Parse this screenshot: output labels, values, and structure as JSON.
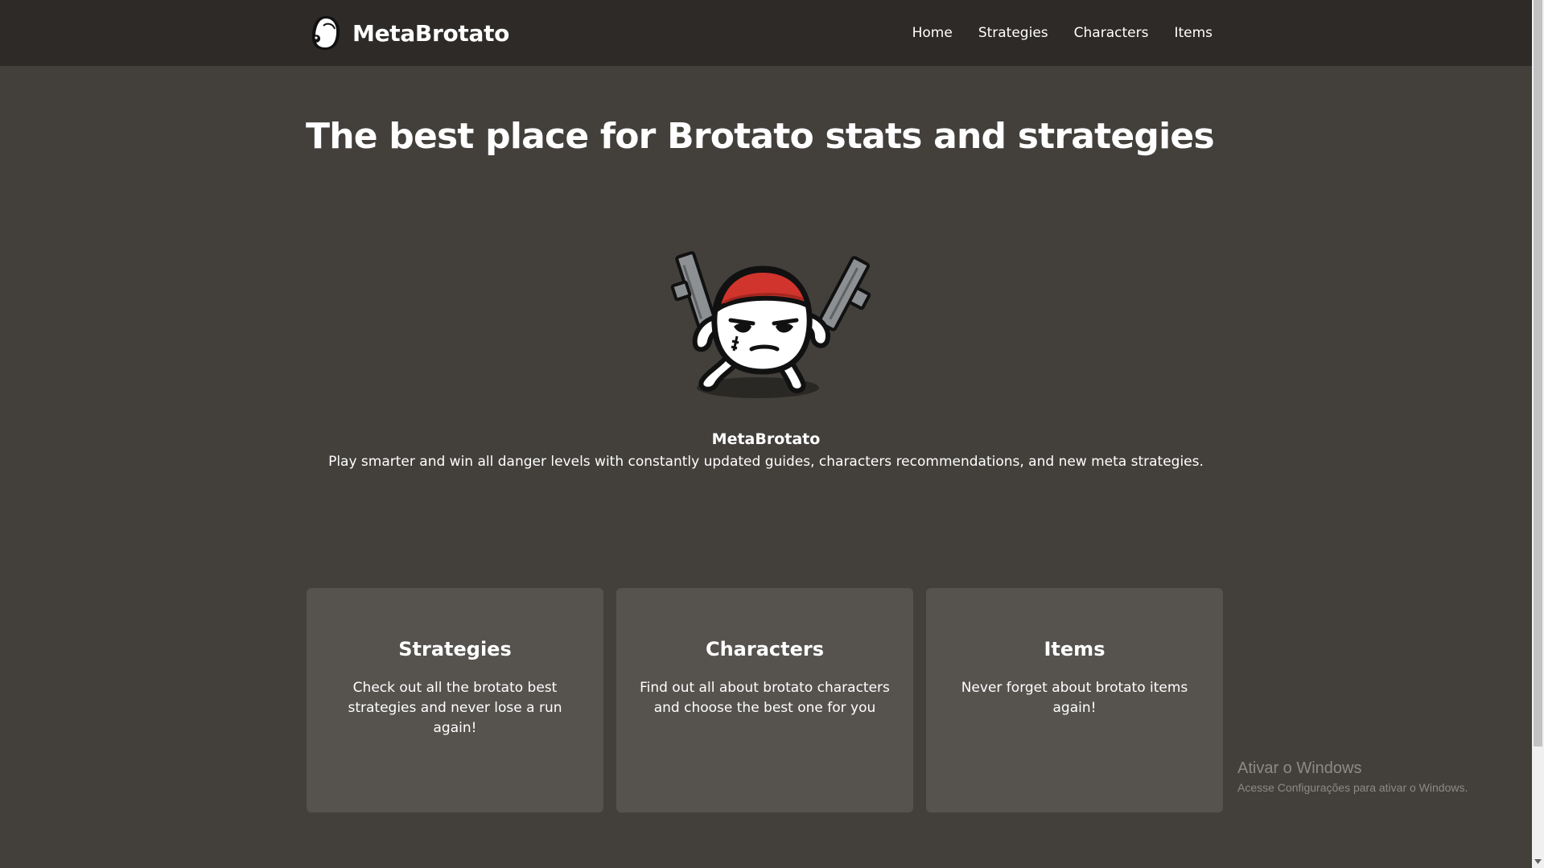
{
  "header": {
    "brand_name": "MetaBrotato",
    "logo_icon": "potato-head-icon",
    "nav": [
      {
        "label": "Home"
      },
      {
        "label": "Strategies"
      },
      {
        "label": "Characters"
      },
      {
        "label": "Items"
      }
    ]
  },
  "hero": {
    "title": "The best place for Brotato stats and strategies",
    "mascot_icon": "brotato-mascot-image",
    "name": "MetaBrotato",
    "description": "Play smarter and win all danger levels with constantly updated guides, characters recommendations, and new meta strategies."
  },
  "cards": [
    {
      "title": "Strategies",
      "description": "Check out all the brotato best strategies and never lose a run again!"
    },
    {
      "title": "Characters",
      "description": "Find out all about brotato characters and choose the best one for you"
    },
    {
      "title": "Items",
      "description": "Never forget about brotato items again!"
    }
  ],
  "watermark": {
    "title": "Ativar o Windows",
    "subtitle": "Acesse Configurações para ativar o Windows."
  },
  "colors": {
    "header_bg": "#2d2a27",
    "page_bg": "#43403c",
    "card_bg": "#56534f",
    "accent_red": "#d0342c"
  }
}
